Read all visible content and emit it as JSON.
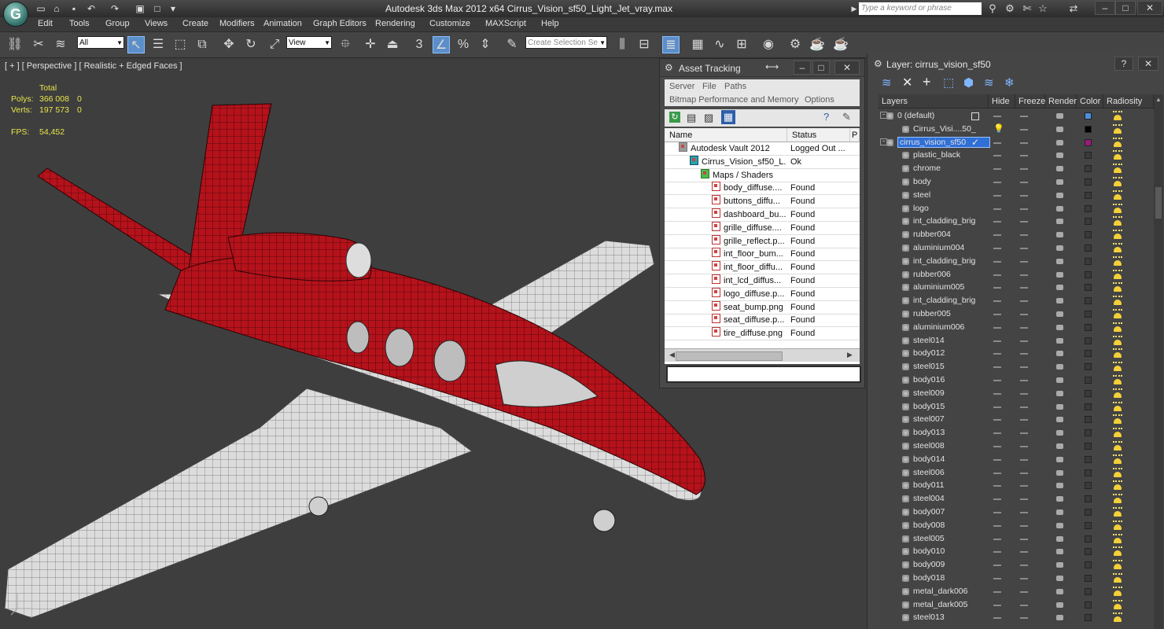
{
  "app": {
    "title": "Autodesk 3ds Max  2012 x64      Cirrus_Vision_sf50_Light_Jet_vray.max",
    "search_placeholder": "Type a keyword or phrase"
  },
  "menu": [
    "Edit",
    "Tools",
    "Group",
    "Views",
    "Create",
    "Modifiers",
    "Animation",
    "Graph Editors",
    "Rendering",
    "Customize",
    "MAXScript",
    "Help"
  ],
  "toolbar": {
    "selection_filter": "All",
    "ref_coord": "View",
    "snap_label": "3",
    "named_selection_placeholder": "Create Selection Se"
  },
  "viewport": {
    "label": "[ + ] [ Perspective ] [ Realistic + Edged Faces ]",
    "stats": {
      "total_label": "Total",
      "polys_label": "Polys:",
      "polys_value": "366 008",
      "polys_sel": "0",
      "verts_label": "Verts:",
      "verts_value": "197 573",
      "verts_sel": "0",
      "fps_label": "FPS:",
      "fps_value": "54,452"
    }
  },
  "asset_tracking": {
    "title": "Asset Tracking",
    "menu_row1": [
      "Server",
      "File",
      "Paths"
    ],
    "menu_row2": [
      "Bitmap Performance and Memory",
      "Options"
    ],
    "columns": [
      "Name",
      "Status",
      "P"
    ],
    "rows": [
      {
        "name": "Autodesk Vault 2012",
        "status": "Logged Out ...",
        "indent": 0,
        "kind": "vault"
      },
      {
        "name": "Cirrus_Vision_sf50_L...",
        "status": "Ok",
        "indent": 1,
        "kind": "max"
      },
      {
        "name": "Maps / Shaders",
        "status": "",
        "indent": 2,
        "kind": "folder"
      },
      {
        "name": "body_diffuse....",
        "status": "Found",
        "indent": 3,
        "kind": "file"
      },
      {
        "name": "buttons_diffu...",
        "status": "Found",
        "indent": 3,
        "kind": "file"
      },
      {
        "name": "dashboard_bu...",
        "status": "Found",
        "indent": 3,
        "kind": "file"
      },
      {
        "name": "grille_diffuse....",
        "status": "Found",
        "indent": 3,
        "kind": "file"
      },
      {
        "name": "grille_reflect.p...",
        "status": "Found",
        "indent": 3,
        "kind": "file"
      },
      {
        "name": "int_floor_bum...",
        "status": "Found",
        "indent": 3,
        "kind": "file"
      },
      {
        "name": "int_floor_diffu...",
        "status": "Found",
        "indent": 3,
        "kind": "file"
      },
      {
        "name": "int_lcd_diffus...",
        "status": "Found",
        "indent": 3,
        "kind": "file"
      },
      {
        "name": "logo_diffuse.p...",
        "status": "Found",
        "indent": 3,
        "kind": "file"
      },
      {
        "name": "seat_bump.png",
        "status": "Found",
        "indent": 3,
        "kind": "file"
      },
      {
        "name": "seat_diffuse.p...",
        "status": "Found",
        "indent": 3,
        "kind": "file"
      },
      {
        "name": "tire_diffuse.png",
        "status": "Found",
        "indent": 3,
        "kind": "file"
      }
    ]
  },
  "layer_panel": {
    "title": "Layer: cirrus_vision_sf50",
    "columns": [
      "Layers",
      "Hide",
      "Freeze",
      "Render",
      "Color",
      "Radiosity"
    ],
    "rows": [
      {
        "name": "0 (default)",
        "level": 0,
        "color": "#4a90e2",
        "extra": "square"
      },
      {
        "name": "Cirrus_Visi....50_",
        "level": 1,
        "color": "#000000",
        "extra": "bulb"
      },
      {
        "name": "cirrus_vision_sf50",
        "level": 0,
        "color": "#9b1b7a",
        "extra": "check",
        "selected": true
      },
      {
        "name": "plastic_black",
        "level": 1
      },
      {
        "name": "chrome",
        "level": 1
      },
      {
        "name": "body",
        "level": 1
      },
      {
        "name": "steel",
        "level": 1
      },
      {
        "name": "logo",
        "level": 1
      },
      {
        "name": "int_cladding_brig",
        "level": 1
      },
      {
        "name": "rubber004",
        "level": 1
      },
      {
        "name": "aluminium004",
        "level": 1
      },
      {
        "name": "int_cladding_brig",
        "level": 1
      },
      {
        "name": "rubber006",
        "level": 1
      },
      {
        "name": "aluminium005",
        "level": 1
      },
      {
        "name": "int_cladding_brig",
        "level": 1
      },
      {
        "name": "rubber005",
        "level": 1
      },
      {
        "name": "aluminium006",
        "level": 1
      },
      {
        "name": "steel014",
        "level": 1
      },
      {
        "name": "body012",
        "level": 1
      },
      {
        "name": "steel015",
        "level": 1
      },
      {
        "name": "body016",
        "level": 1
      },
      {
        "name": "steel009",
        "level": 1
      },
      {
        "name": "body015",
        "level": 1
      },
      {
        "name": "steel007",
        "level": 1
      },
      {
        "name": "body013",
        "level": 1
      },
      {
        "name": "steel008",
        "level": 1
      },
      {
        "name": "body014",
        "level": 1
      },
      {
        "name": "steel006",
        "level": 1
      },
      {
        "name": "body011",
        "level": 1
      },
      {
        "name": "steel004",
        "level": 1
      },
      {
        "name": "body007",
        "level": 1
      },
      {
        "name": "body008",
        "level": 1
      },
      {
        "name": "steel005",
        "level": 1
      },
      {
        "name": "body010",
        "level": 1
      },
      {
        "name": "body009",
        "level": 1
      },
      {
        "name": "body018",
        "level": 1
      },
      {
        "name": "metal_dark006",
        "level": 1
      },
      {
        "name": "metal_dark005",
        "level": 1
      },
      {
        "name": "steel013",
        "level": 1
      }
    ]
  },
  "colors": {
    "accent": "#5c8fc9",
    "viewport_bg": "#3e3e3e",
    "model_red": "#b5121b",
    "stats_yellow": "#e8e54a"
  }
}
